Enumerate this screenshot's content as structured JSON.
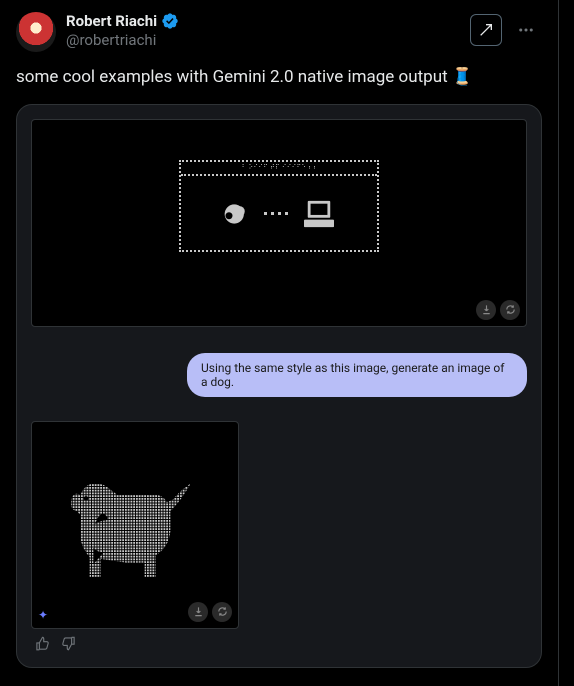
{
  "author": {
    "display_name": "Robert Riachi",
    "handle": "@robertriachi"
  },
  "tweet_text": "some cool examples with Gemini 2.0 native image output",
  "thread_emoji": "🧵",
  "header_icons": {
    "grok": "grok-icon",
    "more": "more-icon"
  },
  "chat": {
    "prompt": "Using the same style as this image, generate an image of a dog."
  },
  "panel_actions": {
    "download": "↓",
    "refresh": "⟳"
  },
  "feedback": {
    "like": "thumbs-up",
    "dislike": "thumbs-down"
  },
  "ascii_title": "⠃ ⠕⠊⠊⠋ ⠞⠏ ⠊⠊⠊⠋⠑⠰⠰"
}
